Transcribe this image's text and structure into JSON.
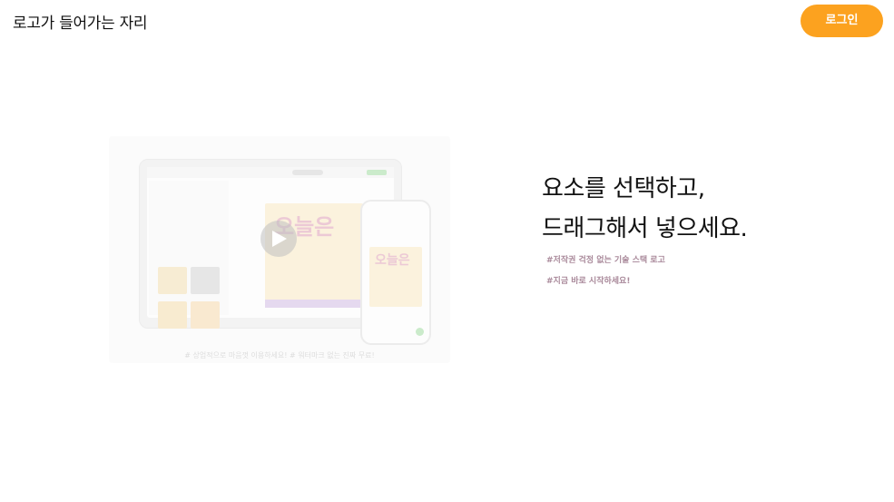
{
  "header": {
    "logo_text": "로고가 들어가는 자리",
    "login_label": "로그인"
  },
  "hero": {
    "headline_line1": "요소를 선택하고,",
    "headline_line2": "드래그해서 넣으세요.",
    "tags": [
      "#저작권 걱정 없는 기술 스택 로고",
      "#지금 바로 시작하세요!"
    ]
  },
  "preview": {
    "poster_title": "오늘은",
    "phone_poster_title": "오늘은",
    "caption": "# 상업적으로 마음껏 이용하세요! # 워터마크 없는 진짜 무료!"
  },
  "colors": {
    "accent": "#fca21f",
    "tag": "#a9899a"
  },
  "icons": {
    "play": "play-icon"
  }
}
